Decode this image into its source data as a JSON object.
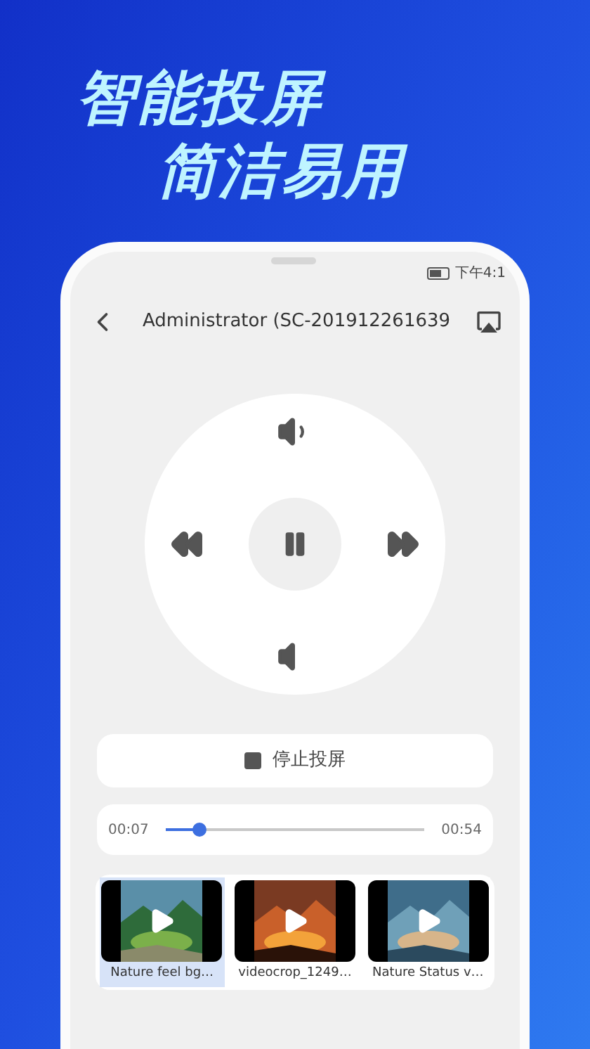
{
  "headline": [
    "智能投屏",
    "简洁易用"
  ],
  "status_bar": {
    "time": "下午4:1"
  },
  "header": {
    "title": "Administrator (SC-201912261639"
  },
  "stop_button": {
    "label": "停止投屏"
  },
  "progress": {
    "elapsed": "00:07",
    "total": "00:54",
    "level": 0.13
  },
  "videos": [
    {
      "caption": "Nature feel bg…",
      "selected": true
    },
    {
      "caption": "videocrop_1249…",
      "selected": false
    },
    {
      "caption": "Nature Status v…",
      "selected": false
    }
  ]
}
